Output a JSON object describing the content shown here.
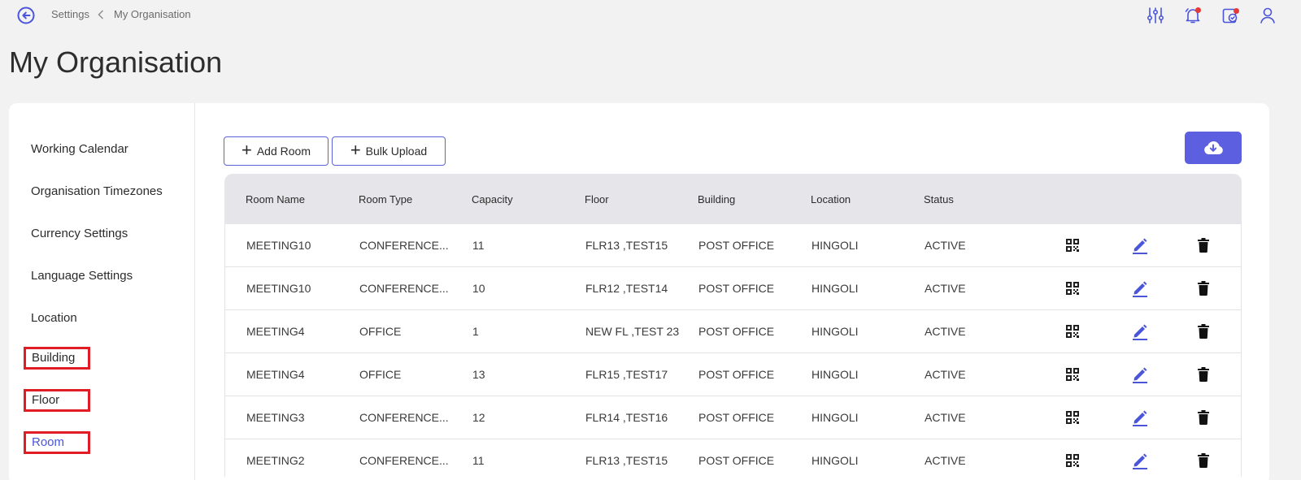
{
  "breadcrumb": {
    "parent": "Settings",
    "current": "My Organisation"
  },
  "page": {
    "title": "My Organisation"
  },
  "colors": {
    "accent": "#5b5fe0",
    "highlight_box": "#e01c24",
    "notification_dot": "#e53935"
  },
  "top_icons": [
    "filter-sliders-icon",
    "notification-bell-icon",
    "calendar-check-icon",
    "user-profile-icon"
  ],
  "sidebar": {
    "items": [
      {
        "label": "Working Calendar"
      },
      {
        "label": "Organisation Timezones"
      },
      {
        "label": "Currency Settings"
      },
      {
        "label": "Language Settings"
      },
      {
        "label": "Location"
      },
      {
        "label": "Building"
      },
      {
        "label": "Floor"
      },
      {
        "label": "Room"
      }
    ]
  },
  "toolbar": {
    "add_room_label": "Add Room",
    "bulk_upload_label": "Bulk Upload"
  },
  "table": {
    "columns": [
      "Room Name",
      "Room Type",
      "Capacity",
      "Floor",
      "Building",
      "Location",
      "Status"
    ],
    "rows": [
      {
        "name": "MEETING10",
        "type": "CONFERENCE...",
        "capacity": "11",
        "floor": "FLR13 ,TEST15",
        "building": "POST OFFICE",
        "location": "HINGOLI",
        "status": "ACTIVE"
      },
      {
        "name": "MEETING10",
        "type": "CONFERENCE...",
        "capacity": "10",
        "floor": "FLR12 ,TEST14",
        "building": "POST OFFICE",
        "location": "HINGOLI",
        "status": "ACTIVE"
      },
      {
        "name": "MEETING4",
        "type": "OFFICE",
        "capacity": "1",
        "floor": "NEW FL ,TEST 23",
        "building": "POST OFFICE",
        "location": "HINGOLI",
        "status": "ACTIVE"
      },
      {
        "name": "MEETING4",
        "type": "OFFICE",
        "capacity": "13",
        "floor": "FLR15 ,TEST17",
        "building": "POST OFFICE",
        "location": "HINGOLI",
        "status": "ACTIVE"
      },
      {
        "name": "MEETING3",
        "type": "CONFERENCE...",
        "capacity": "12",
        "floor": "FLR14 ,TEST16",
        "building": "POST OFFICE",
        "location": "HINGOLI",
        "status": "ACTIVE"
      },
      {
        "name": "MEETING2",
        "type": "CONFERENCE...",
        "capacity": "11",
        "floor": "FLR13 ,TEST15",
        "building": "POST OFFICE",
        "location": "HINGOLI",
        "status": "ACTIVE"
      }
    ]
  }
}
